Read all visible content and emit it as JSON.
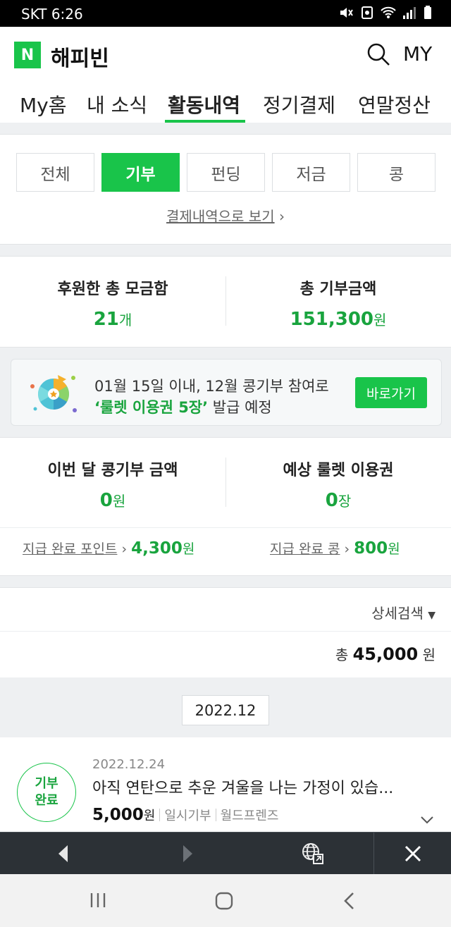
{
  "status": {
    "carrier_time": "SKT 6:26"
  },
  "header": {
    "logo_letter": "N",
    "brand": "해피빈",
    "my_label": "MY",
    "search_icon": "search-icon"
  },
  "tabs": [
    {
      "label": "My홈"
    },
    {
      "label": "내 소식"
    },
    {
      "label": "활동내역"
    },
    {
      "label": "정기결제"
    },
    {
      "label": "연말정산"
    }
  ],
  "filters": [
    {
      "label": "전체"
    },
    {
      "label": "기부"
    },
    {
      "label": "펀딩"
    },
    {
      "label": "저금"
    },
    {
      "label": "콩"
    }
  ],
  "pay_link": "결제내역으로 보기",
  "stats": {
    "funds_label": "후원한 총 모금함",
    "funds_value": "21",
    "funds_unit": "개",
    "donation_label": "총 기부금액",
    "donation_value": "151,300",
    "donation_unit": "원"
  },
  "banner": {
    "line1": "01월 15일 이내, 12월 콩기부 참여로",
    "line2_highlight": "‘룰렛 이용권 5장’",
    "line2_rest": " 발급 예정",
    "button": "바로가기"
  },
  "koin": {
    "month_label": "이번 달 콩기부 금액",
    "month_value": "0",
    "month_unit": "원",
    "roulette_label": "예상 룰렛 이용권",
    "roulette_value": "0",
    "roulette_unit": "장",
    "point_label": "지급 완료 포인트",
    "point_value": "4,300",
    "point_unit": "원",
    "kong_label": "지급 완료 콩",
    "kong_value": "800",
    "kong_unit": "원"
  },
  "list": {
    "detail_search": "상세검색",
    "total_prefix": "총",
    "total_value": "45,000",
    "total_unit": "원",
    "month": "2022.12",
    "items": [
      {
        "badge_line1": "기부",
        "badge_line2": "완료",
        "date": "2022.12.24",
        "title": "아직 연탄으로 추운 겨울을 나는 가정이 있습...",
        "amount": "5,000",
        "amount_unit": "원",
        "type": "일시기부",
        "org": "월드프렌즈"
      }
    ]
  },
  "colors": {
    "accent": "#19c44a",
    "accent_text": "#19a43e",
    "toolbar": "#2c3136"
  }
}
